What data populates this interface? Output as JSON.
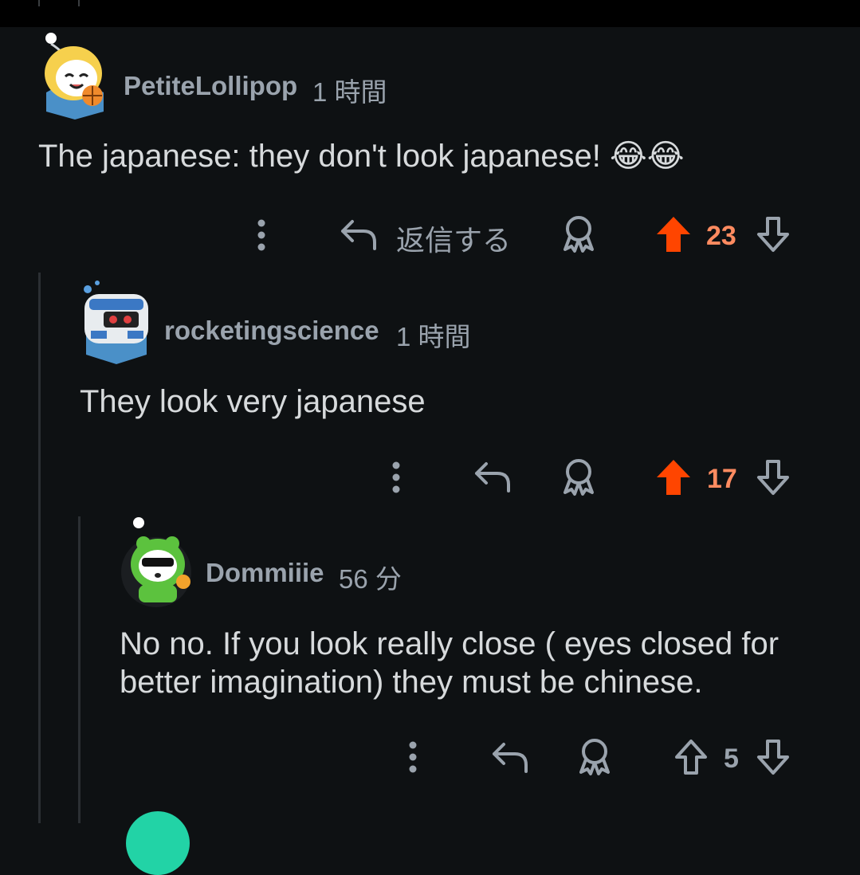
{
  "colors": {
    "upvote_active": "#ff4500",
    "score_active": "#ff8b60",
    "muted": "#9aa3ad",
    "background": "#0e1113"
  },
  "comments": [
    {
      "username": "PetiteLollipop",
      "time": "1 時間",
      "text": "The japanese: they don't look japanese! 😂😂",
      "reply_label": "返信する",
      "score": "23",
      "upvoted": true,
      "avatar_icon": "snoo-avatar-girl-basketball"
    },
    {
      "username": "rocketingscience",
      "time": "1 時間",
      "text": "They look very japanese",
      "score": "17",
      "upvoted": true,
      "avatar_icon": "snoo-avatar-robot"
    },
    {
      "username": "Dommiiie",
      "time": "56 分",
      "text_lines": [
        "No no. If you look really close ( eyes closed for",
        "better imagination) they must be chinese."
      ],
      "score": "5",
      "upvoted": false,
      "avatar_icon": "snoo-avatar-frog-hoodie"
    }
  ]
}
